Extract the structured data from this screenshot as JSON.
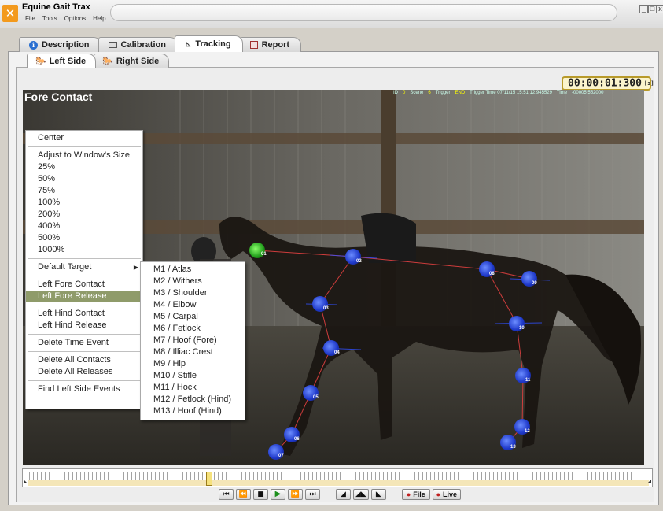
{
  "app": {
    "title": "Equine Gait Trax",
    "menu": [
      "File",
      "Tools",
      "Options",
      "Help"
    ],
    "window_controls": [
      "_",
      "□",
      "x"
    ]
  },
  "main_tabs": [
    {
      "label": "Description",
      "icon": "info-icon",
      "active": false
    },
    {
      "label": "Calibration",
      "icon": "calibration-icon",
      "active": false
    },
    {
      "label": "Tracking",
      "icon": "tracking-icon",
      "active": true
    },
    {
      "label": "Report",
      "icon": "report-icon",
      "active": false
    }
  ],
  "side_tabs": [
    {
      "label": "Left Side",
      "icon": "horse-icon",
      "active": true
    },
    {
      "label": "Right Side",
      "icon": "horse-icon",
      "active": false
    }
  ],
  "timecode": {
    "value": "00:00:01:300",
    "unit": "[s]"
  },
  "video": {
    "title": "Fore Contact",
    "overlay": [
      "ID",
      "0",
      "Scene",
      "6",
      "Trigger",
      "END",
      "Trigger Time 07/11/15 15:51:12.945529",
      "Time",
      "-00005.552000"
    ]
  },
  "markers": [
    {
      "label": "01",
      "color": "green"
    },
    {
      "label": "02",
      "color": "blue"
    },
    {
      "label": "03",
      "color": "blue"
    },
    {
      "label": "04",
      "color": "blue"
    },
    {
      "label": "05",
      "color": "blue"
    },
    {
      "label": "06",
      "color": "blue"
    },
    {
      "label": "07",
      "color": "blue"
    },
    {
      "label": "08",
      "color": "blue"
    },
    {
      "label": "09",
      "color": "blue"
    },
    {
      "label": "10",
      "color": "blue"
    },
    {
      "label": "11",
      "color": "blue"
    },
    {
      "label": "12",
      "color": "blue"
    },
    {
      "label": "13",
      "color": "blue"
    }
  ],
  "context_menu": {
    "center": "Center",
    "zoom": [
      "Adjust to Window's Size",
      "25%",
      "50%",
      "75%",
      "100%",
      "200%",
      "400%",
      "500%",
      "1000%"
    ],
    "default_target": "Default Target",
    "fore": [
      "Left Fore Contact",
      "Left Fore Release"
    ],
    "hind": [
      "Left Hind Contact",
      "Left Hind Release"
    ],
    "delete_time": "Delete Time Event",
    "delete_all": [
      "Delete All Contacts",
      "Delete All Releases"
    ],
    "find": "Find Left Side Events",
    "highlighted": "Left Fore Release"
  },
  "submenu": [
    "M1 / Atlas",
    "M2 / Withers",
    "M3 / Shoulder",
    "M4 / Elbow",
    "M5 / Carpal",
    "M6 / Fetlock",
    "M7 / Hoof (Fore)",
    "M8 / Illiac Crest",
    "M9 / Hip",
    "M10 / Stifle",
    "M11 / Hock",
    "M12 / Fetlock (Hind)",
    "M13 / Hoof (Hind)"
  ],
  "controls": {
    "file": "File",
    "live": "Live"
  }
}
